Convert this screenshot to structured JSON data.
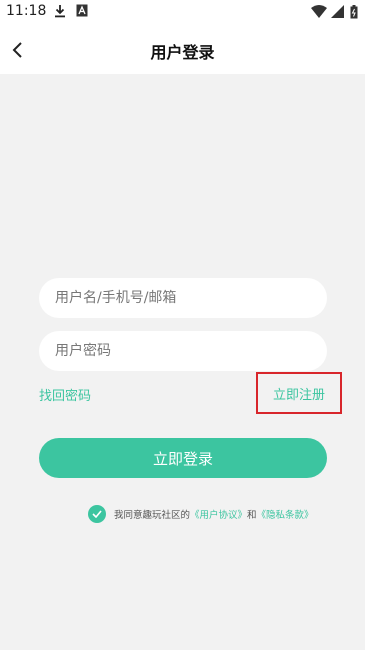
{
  "status_bar": {
    "time": "11:18",
    "left_icons": [
      "download-icon",
      "a-notification-icon"
    ],
    "right_icons": [
      "wifi-icon",
      "signal-icon",
      "battery-icon"
    ]
  },
  "nav": {
    "back_icon": "back-arrow-icon",
    "title": "用户登录"
  },
  "form": {
    "username_placeholder": "用户名/手机号/邮箱",
    "password_placeholder": "用户密码",
    "forgot_link": "找回密码",
    "register_link": "立即注册",
    "login_button": "立即登录"
  },
  "agreement": {
    "checked": true,
    "prefix": "我同意趣玩社区的",
    "user_agreement": "《用户协议》",
    "conjunction": "和",
    "privacy_policy": "《隐私条款》"
  },
  "colors": {
    "accent": "#3cc5a0",
    "highlight_border": "#d8262b",
    "background": "#f2f2f2"
  }
}
